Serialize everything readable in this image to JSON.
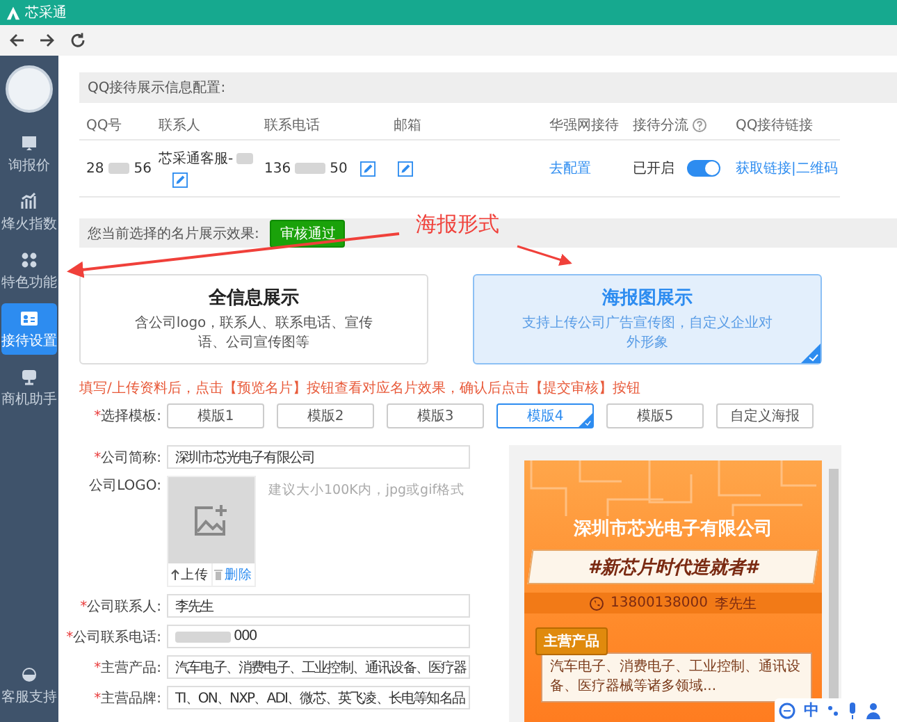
{
  "window": {
    "title": "芯采通"
  },
  "sidebar": {
    "items": [
      {
        "label": "询报价",
        "selected": false
      },
      {
        "label": "烽火指数",
        "selected": false
      },
      {
        "label": "特色功能",
        "selected": false
      },
      {
        "label": "接待设置",
        "selected": true
      },
      {
        "label": "商机助手",
        "selected": false
      }
    ],
    "footer_item": {
      "label": "客服支持"
    }
  },
  "qq_config": {
    "title": "QQ接待展示信息配置:",
    "columns": [
      "QQ号",
      "联系人",
      "联系电话",
      "邮箱",
      "华强网接待",
      "接待分流",
      "QQ接待链接"
    ],
    "row": {
      "qq": {
        "prefix": "28",
        "suffix": "56"
      },
      "contact": {
        "prefix": "芯采通客服-"
      },
      "phone": {
        "prefix": "136",
        "suffix": "50"
      },
      "reception_link": "去配置",
      "split_status": "已开启",
      "split_on": true,
      "qq_link": "获取链接|二维码"
    }
  },
  "display": {
    "label": "您当前选择的名片展示效果:",
    "status_badge": "审核通过",
    "options": [
      {
        "title": "全信息展示",
        "description": "含公司logo，联系人、联系电话、宣传语、公司宣传图等",
        "selected": false
      },
      {
        "title": "海报图展示",
        "description": "支持上传公司广告宣传图，自定义企业对外形象",
        "selected": true
      }
    ]
  },
  "form": {
    "instruction": "填写/上传资料后，点击【预览名片】按钮查看对应名片效果，确认后点击【提交审核】按钮",
    "template_required_mark": "*",
    "template_label": "选择模板:",
    "templates": [
      {
        "label": "模版1",
        "selected": false
      },
      {
        "label": "模版2",
        "selected": false
      },
      {
        "label": "模版3",
        "selected": false
      },
      {
        "label": "模版4",
        "selected": true
      },
      {
        "label": "模版5",
        "selected": false
      },
      {
        "label": "自定义海报",
        "selected": false
      }
    ],
    "fields": [
      {
        "kind": "text",
        "required_mark": "*",
        "label": "公司简称:",
        "value": "深圳市芯光电子有限公司"
      },
      {
        "kind": "logo",
        "label": "公司LOGO:",
        "hint": "建议大小100K内，jpg或gif格式",
        "upload": "上传",
        "delete": "删除"
      },
      {
        "kind": "text",
        "required_mark": "*",
        "label": "公司联系人:",
        "value": "李先生"
      },
      {
        "kind": "masked",
        "required_mark": "*",
        "label": "公司联系电话:",
        "suffix": "000"
      },
      {
        "kind": "text",
        "required_mark": "*",
        "label": "主营产品:",
        "value": "汽车电子、消费电子、工业控制、通讯设备、医疗器"
      },
      {
        "kind": "text",
        "required_mark": "*",
        "label": "主营品牌:",
        "value": "TI、ON、NXP、ADI、微芯、英飞凌、长电等知名品"
      }
    ]
  },
  "preview": {
    "company": "深圳市芯光电子有限公司",
    "slogan": "#新芯片时代造就者#",
    "phone": "13800138000",
    "contact": "李先生",
    "section_title": "主营产品",
    "products": "汽车电子、消费电子、工业控制、通讯设备、医疗器械等诸多领域..."
  },
  "annotations": [
    {
      "text": "海报形式"
    }
  ],
  "ime_toolbar": {
    "language": "中"
  }
}
